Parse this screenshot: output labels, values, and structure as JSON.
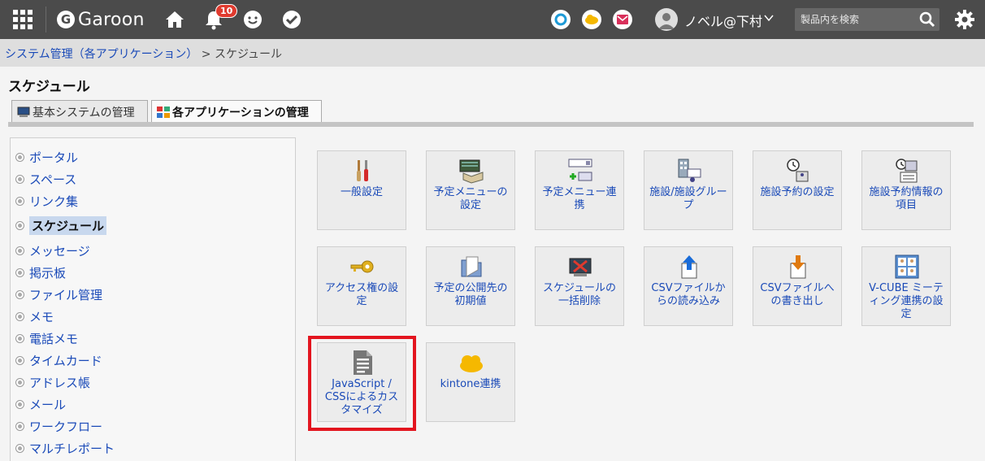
{
  "header": {
    "logo_text": "Garoon",
    "notification_count": "10",
    "user_name": "ノベル@下村",
    "search_placeholder": "製品内を検索"
  },
  "breadcrumb": {
    "parent": "システム管理（各アプリケーション）",
    "separator": ">",
    "current": "スケジュール"
  },
  "page_title": "スケジュール",
  "tabs": [
    {
      "label": "基本システムの管理"
    },
    {
      "label": "各アプリケーションの管理"
    }
  ],
  "sidebar": {
    "items": [
      {
        "label": "ポータル"
      },
      {
        "label": "スペース"
      },
      {
        "label": "リンク集"
      },
      {
        "label": "スケジュール"
      },
      {
        "label": "メッセージ"
      },
      {
        "label": "掲示板"
      },
      {
        "label": "ファイル管理"
      },
      {
        "label": "メモ"
      },
      {
        "label": "電話メモ"
      },
      {
        "label": "タイムカード"
      },
      {
        "label": "アドレス帳"
      },
      {
        "label": "メール"
      },
      {
        "label": "ワークフロー"
      },
      {
        "label": "マルチレポート"
      }
    ]
  },
  "tiles": [
    {
      "label": "一般設定",
      "icon": "tools-icon"
    },
    {
      "label": "予定メニューの設定",
      "icon": "menu-book-icon"
    },
    {
      "label": "予定メニュー連携",
      "icon": "menu-link-icon"
    },
    {
      "label": "施設/施設グループ",
      "icon": "facility-icon"
    },
    {
      "label": "施設予約の設定",
      "icon": "reservation-settings-icon"
    },
    {
      "label": "施設予約情報の項目",
      "icon": "reservation-items-icon"
    },
    {
      "label": "アクセス権の設定",
      "icon": "key-icon"
    },
    {
      "label": "予定の公開先の初期値",
      "icon": "folder-icon"
    },
    {
      "label": "スケジュールの一括削除",
      "icon": "bulk-delete-icon"
    },
    {
      "label": "CSVファイルからの読み込み",
      "icon": "csv-import-icon"
    },
    {
      "label": "CSVファイルへの書き出し",
      "icon": "csv-export-icon"
    },
    {
      "label": "V-CUBE ミーティング連携の設定",
      "icon": "v-cube-icon"
    },
    {
      "label": "JavaScript / CSSによるカスタマイズ",
      "icon": "document-icon"
    },
    {
      "label": "kintone連携",
      "icon": "kintone-cloud-icon"
    }
  ],
  "colors": {
    "topbar": "#4b4b4b",
    "link": "#1a4ab8",
    "highlight": "#e3151f",
    "badge": "#e03a2e"
  }
}
